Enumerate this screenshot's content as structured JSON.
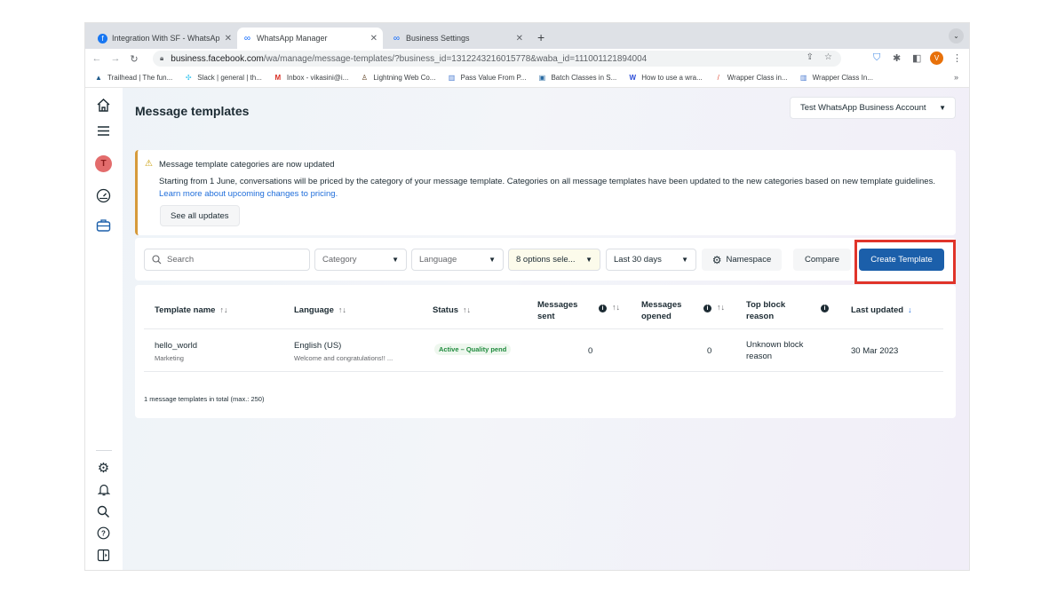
{
  "browser": {
    "tabs": [
      {
        "label": "Integration With SF - WhatsAp",
        "icon": "facebook-icon",
        "active": false
      },
      {
        "label": "WhatsApp Manager",
        "icon": "meta-icon",
        "active": true
      },
      {
        "label": "Business Settings",
        "icon": "meta-icon",
        "active": false
      }
    ],
    "new_tab": "+",
    "tab_menu": "⌄",
    "url_host": "business.facebook.com",
    "url_path": "/wa/manage/message-templates/?business_id=1312243216015778&waba_id=111001121894004",
    "profile_initial": "V",
    "bookmarks": [
      {
        "label": "Trailhead | The fun...",
        "icon": "trailhead-icon"
      },
      {
        "label": "Slack | general | th...",
        "icon": "slack-icon"
      },
      {
        "label": "Inbox - vikasini@i...",
        "icon": "gmail-icon"
      },
      {
        "label": "Lightning Web Co...",
        "icon": "person-icon"
      },
      {
        "label": "Pass Value From P...",
        "icon": "chart-icon"
      },
      {
        "label": "Batch Classes in S...",
        "icon": "page-icon"
      },
      {
        "label": "How to use a wra...",
        "icon": "w-icon"
      },
      {
        "label": "Wrapper Class in...",
        "icon": "pen-icon"
      },
      {
        "label": "Wrapper Class In...",
        "icon": "chart-icon"
      }
    ],
    "bookmarks_more": "»"
  },
  "rail": {
    "avatar_initial": "T"
  },
  "header": {
    "title": "Message templates",
    "account_selector": "Test WhatsApp Business Account"
  },
  "banner": {
    "title": "Message template categories are now updated",
    "body": "Starting from 1 June, conversations will be priced by the category of your message template. Categories on all message templates have been updated to the new categories based on new template guidelines.",
    "link": "Learn more about upcoming changes to pricing.",
    "button": "See all updates",
    "accent_color": "#d69a3a"
  },
  "filters": {
    "search_placeholder": "Search",
    "category": "Category",
    "language": "Language",
    "status": "8 options sele...",
    "date_range": "Last 30 days",
    "namespace": "Namespace",
    "compare": "Compare",
    "create": "Create Template",
    "primary_color": "#1b5faa",
    "highlight_color": "#e0342a"
  },
  "table": {
    "headers": {
      "name": "Template name",
      "language": "Language",
      "status": "Status",
      "sent": "Messages sent",
      "opened": "Messages opened",
      "block": "Top block reason",
      "updated": "Last updated"
    },
    "rows": [
      {
        "name": "hello_world",
        "category": "Marketing",
        "language": "English (US)",
        "preview": "Welcome and congratulations!! ...",
        "status": "Active – Quality pend",
        "sent": "0",
        "opened": "0",
        "block_reason": "Unknown block reason",
        "last_updated": "30 Mar 2023"
      }
    ],
    "total": "1 message templates in total (max.: 250)"
  }
}
